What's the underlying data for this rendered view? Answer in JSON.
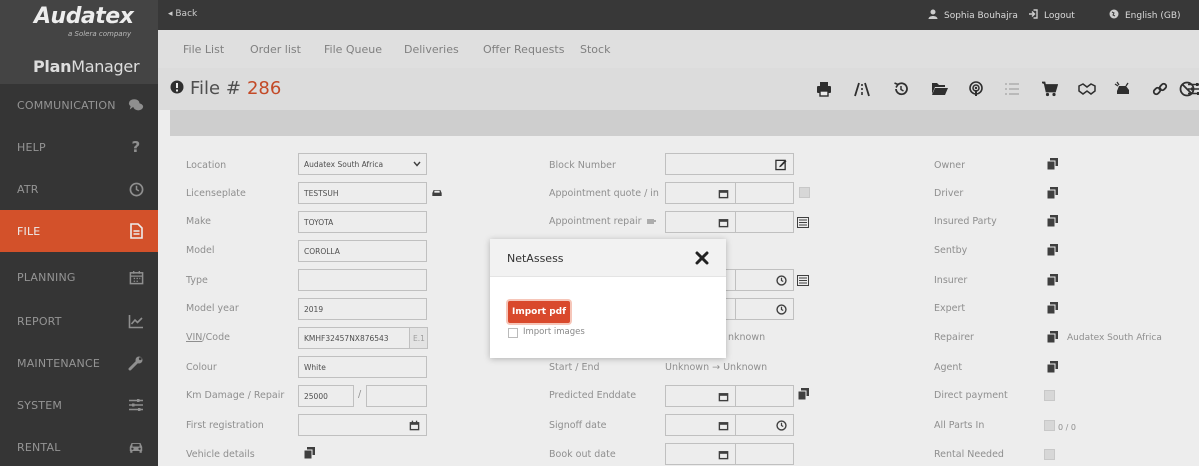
{
  "brand": {
    "logo": "Audatex",
    "sub": "a Solera company",
    "pm_bold": "Plan",
    "pm_rest": "Manager"
  },
  "sidebar": {
    "items": [
      {
        "label": "COMMUNICATION",
        "icon": "chat-icon"
      },
      {
        "label": "HELP",
        "icon": "question-icon"
      },
      {
        "label": "ATR",
        "icon": "clock-icon"
      },
      {
        "label": "FILE",
        "icon": "file-icon",
        "active": true
      },
      {
        "label": "PLANNING",
        "icon": "calendar-icon"
      },
      {
        "label": "REPORT",
        "icon": "chart-icon"
      },
      {
        "label": "MAINTENANCE",
        "icon": "wrench-icon"
      },
      {
        "label": "SYSTEM",
        "icon": "sliders-icon"
      },
      {
        "label": "RENTAL",
        "icon": "car-icon"
      }
    ]
  },
  "topbar": {
    "back": "◂ Back",
    "user": "Sophia Bouhajra",
    "logout": "Logout",
    "language": "English (GB)"
  },
  "tabs": [
    "File List",
    "Order list",
    "File Queue",
    "Deliveries",
    "Offer Requests",
    "Stock"
  ],
  "file": {
    "prefix": "File #",
    "number": "286"
  },
  "form": {
    "location_label": "Location",
    "location_value": "Audatex South Africa",
    "licenseplate_label": "Licenseplate",
    "licenseplate_value": "TESTSUH",
    "make_label": "Make",
    "make_value": "TOYOTA",
    "model_label": "Model",
    "model_value": "COROLLA",
    "type_label": "Type",
    "type_value": "",
    "modelyear_label": "Model year",
    "modelyear_value": "2019",
    "vin_label_u": "VIN",
    "vin_label_rest": "/Code",
    "vin_value": "KMHF32457NX876543",
    "vin_suffix": "E.1",
    "colour_label": "Colour",
    "colour_value": "White",
    "km_label": "Km Damage / Repair",
    "km_value": "25000",
    "km_sep": "/",
    "firstreg_label": "First registration",
    "vehicledetails_label": "Vehicle details",
    "block_label": "Block Number",
    "apptquote_label": "Appointment quote / in",
    "apptrepair_label": "Appointment repair",
    "unknown_partial": "nknown",
    "startend_label": "Start / End",
    "startend_value": "Unknown → Unknown",
    "predicted_label": "Predicted Enddate",
    "signoff_label": "Signoff date",
    "bookout_label": "Book out date",
    "owner_label": "Owner",
    "driver_label": "Driver",
    "insured_label": "Insured Party",
    "sentby_label": "Sentby",
    "insurer_label": "Insurer",
    "expert_label": "Expert",
    "repairer_label": "Repairer",
    "repairer_value": "Audatex South Africa",
    "agent_label": "Agent",
    "directpay_label": "Direct payment",
    "allparts_label": "All Parts In",
    "allparts_value": "0 / 0",
    "rental_label": "Rental Needed"
  },
  "modal": {
    "title": "NetAssess",
    "import_button": "Import pdf",
    "import_images_label": "Import images"
  },
  "colors": {
    "accent": "#e4582e",
    "sidebar": "#3a3a3a",
    "topbar": "#3d3d3d",
    "file_number": "#d2502b",
    "import_button": "#d9492c"
  }
}
